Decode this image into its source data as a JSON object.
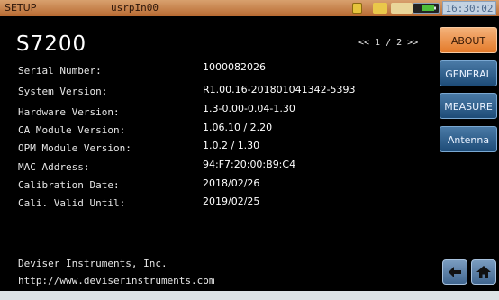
{
  "title_bar": {
    "app_name": "SETUP",
    "user": "usrpIn00",
    "clock": "16:30:02"
  },
  "about": {
    "model": "S7200",
    "pager": "<< 1 / 2 >>",
    "labels": [
      "Serial Number:",
      "System Version:",
      "Hardware Version:",
      "CA Module Version:",
      "OPM Module Version:",
      "MAC Address:",
      "Calibration Date:",
      "Cali. Valid Until:"
    ],
    "values": [
      "1000082026",
      "R1.00.16-201801041342-5393",
      "1.3-0.00-0.04-1.30",
      "1.06.10 / 2.20",
      "1.0.2 / 1.30",
      "94:F7:20:00:B9:C4",
      "2018/02/26",
      "2019/02/25"
    ],
    "company": "Deviser Instruments, Inc.",
    "website": "http://www.deviserinstruments.com"
  },
  "menu": {
    "about": "ABOUT",
    "general": "GENERAL",
    "measure": "MEASURE",
    "antenna": "Antenna"
  },
  "nav": {
    "back_icon": "back-arrow-icon",
    "home_icon": "home-icon"
  },
  "colors": {
    "title_bar": "#c47a40",
    "menu_active": "#e8843a",
    "menu_inactive": "#2e5e8c",
    "background": "#000000"
  }
}
